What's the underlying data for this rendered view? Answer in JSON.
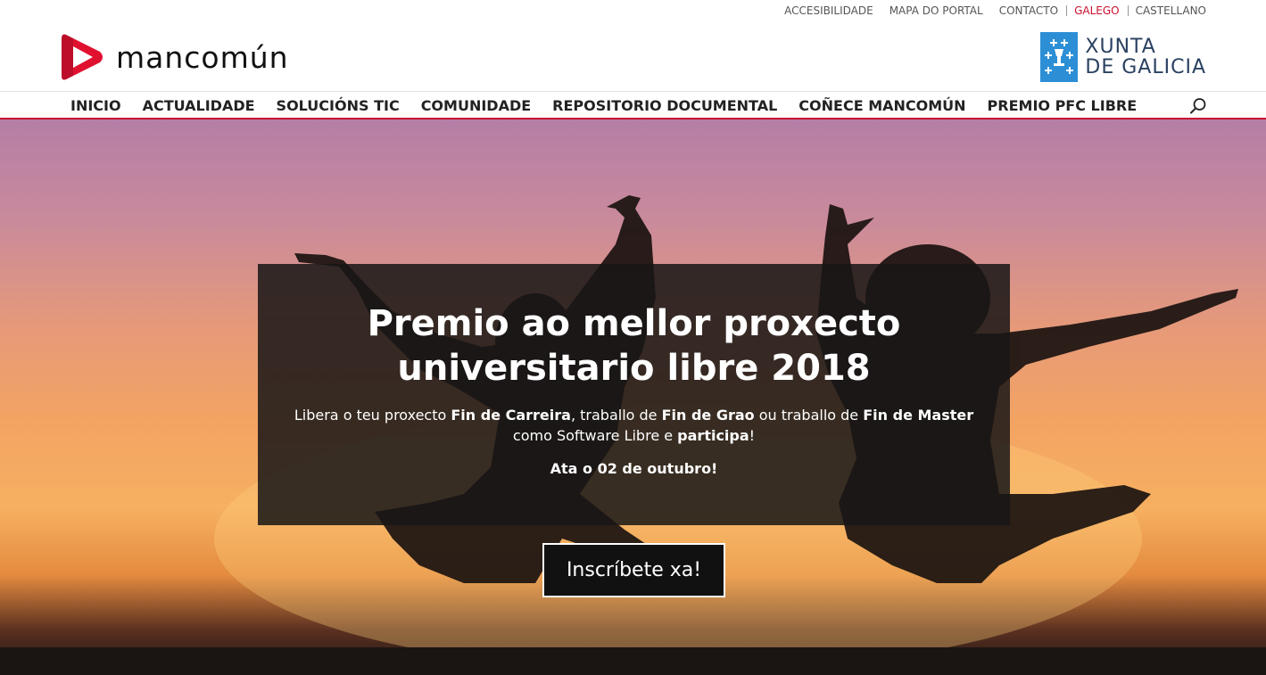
{
  "utility": {
    "links": [
      "ACCESIBILIDADE",
      "MAPA DO PORTAL",
      "CONTACTO"
    ],
    "languages": [
      "GALEGO",
      "CASTELLANO"
    ],
    "active_language": "GALEGO"
  },
  "header": {
    "logo_text": "mancomún",
    "xunta_line1": "XUNTA",
    "xunta_line2": "DE GALICIA"
  },
  "nav": {
    "items": [
      "INICIO",
      "ACTUALIDADE",
      "SOLUCIÓNS TIC",
      "COMUNIDADE",
      "REPOSITORIO DOCUMENTAL",
      "COÑECE MANCOMÚN",
      "PREMIO PFC LIBRE"
    ],
    "search_icon": "search-icon"
  },
  "hero": {
    "title": "Premio ao mellor proxecto universitario libre 2018",
    "desc_1": "Libera o teu proxecto ",
    "desc_b1": "Fin de Carreira",
    "desc_2": ", traballo de ",
    "desc_b2": "Fin de Grao",
    "desc_3": " ou traballo de ",
    "desc_b3": "Fin de Master",
    "desc_4": " como Software Libre e ",
    "desc_b4": "participa",
    "desc_5": "!",
    "deadline": "Ata o 02 de outubro!",
    "cta": "Inscríbete xa!"
  },
  "colors": {
    "brand_red": "#c8102e",
    "xunta_blue": "#2c8fd6"
  }
}
